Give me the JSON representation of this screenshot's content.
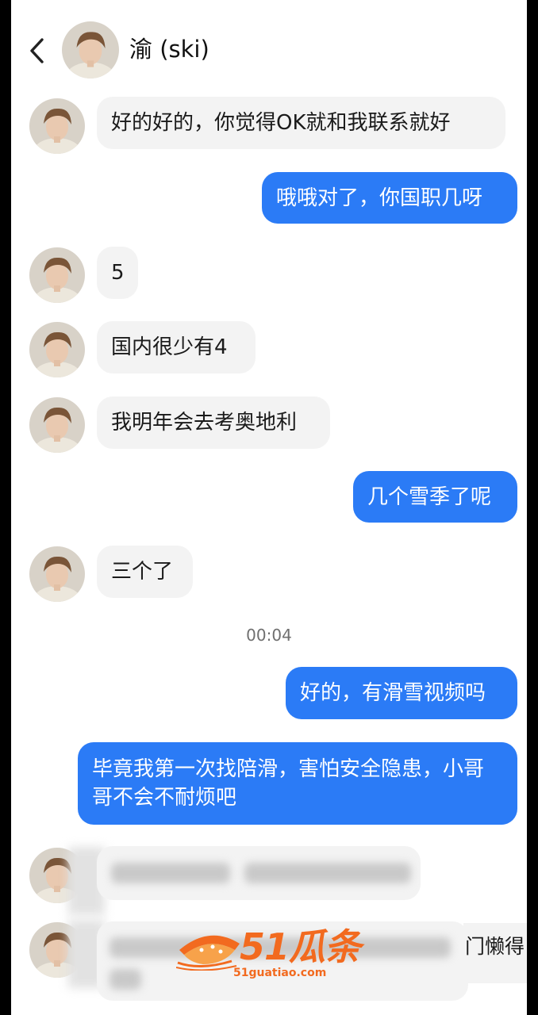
{
  "header": {
    "contact_name": "渝 (ski)"
  },
  "messages": [
    {
      "side": "in",
      "text": "好的好的，你觉得OK就和我联系就好"
    },
    {
      "side": "out",
      "text": "哦哦对了，你国职几呀"
    },
    {
      "side": "in",
      "text": "5"
    },
    {
      "side": "in",
      "text": "国内很少有4"
    },
    {
      "side": "in",
      "text": "我明年会去考奥地利"
    },
    {
      "side": "out",
      "text": "几个雪季了呢"
    },
    {
      "side": "in",
      "text": "三个了"
    },
    {
      "side": "out",
      "text": "好的，有滑雪视频吗"
    },
    {
      "side": "out",
      "text": "毕竟我第一次找陪滑，害怕安全隐患，小哥哥不会不耐烦吧"
    }
  ],
  "timestamp": "00:04",
  "blurred_tail": "门懒得",
  "watermark": {
    "brand": "51瓜条",
    "domain": "51guatiao.com"
  },
  "colors": {
    "outgoing_bubble": "#2b7bf6",
    "incoming_bubble": "#f3f3f3",
    "watermark": "#f26a1f"
  }
}
